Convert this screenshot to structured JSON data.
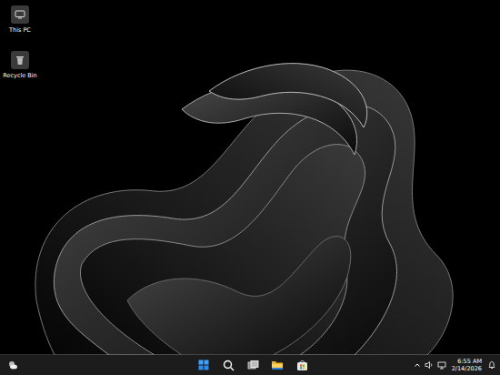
{
  "desktop": {
    "icons": [
      {
        "label": "This PC"
      },
      {
        "label": "Recycle Bin"
      }
    ]
  },
  "taskbar": {
    "clock": {
      "time": "6:55 AM",
      "date": "2/14/2026"
    }
  }
}
